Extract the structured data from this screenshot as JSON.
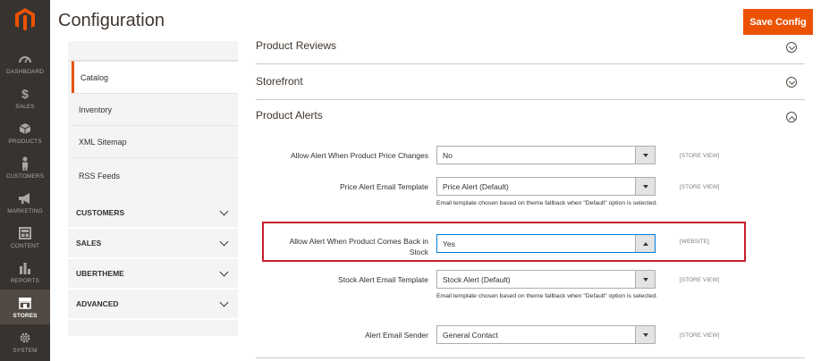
{
  "page": {
    "title": "Configuration",
    "save_label": "Save Config"
  },
  "colors": {
    "accent": "#eb5202",
    "nav_bg": "#373330",
    "highlight": "#c81d2c"
  },
  "admin_nav": [
    {
      "label": "DASHBOARD",
      "icon": "dashboard-icon"
    },
    {
      "label": "SALES",
      "icon": "dollar-icon"
    },
    {
      "label": "PRODUCTS",
      "icon": "cube-icon"
    },
    {
      "label": "CUSTOMERS",
      "icon": "person-icon"
    },
    {
      "label": "MARKETING",
      "icon": "megaphone-icon"
    },
    {
      "label": "CONTENT",
      "icon": "layout-icon"
    },
    {
      "label": "REPORTS",
      "icon": "bar-chart-icon"
    },
    {
      "label": "STORES",
      "icon": "store-icon",
      "active": true
    },
    {
      "label": "SYSTEM",
      "icon": "gear-icon"
    }
  ],
  "config_tabs": {
    "catalog_items": [
      "Catalog",
      "Inventory",
      "XML Sitemap",
      "RSS Feeds"
    ],
    "groups": [
      "CUSTOMERS",
      "SALES",
      "UBERTHEME",
      "ADVANCED"
    ]
  },
  "sections": {
    "product_reviews": "Product Reviews",
    "storefront": "Storefront",
    "product_alerts": "Product Alerts"
  },
  "product_alerts": {
    "rows": [
      {
        "label": "Allow Alert When Product Price Changes",
        "value": "No",
        "scope": "[STORE VIEW]"
      },
      {
        "label": "Price Alert Email Template",
        "value": "Price Alert (Default)",
        "scope": "[STORE VIEW]",
        "note": "Email template chosen based on theme fallback when \"Default\" option is selected."
      },
      {
        "label": "Allow Alert When Product Comes Back in Stock",
        "value": "Yes",
        "scope": "[WEBSITE]"
      },
      {
        "label": "Stock Alert Email Template",
        "value": "Stock Alert (Default)",
        "scope": "[STORE VIEW]",
        "note": "Email template chosen based on theme fallback when \"Default\" option is selected."
      },
      {
        "label": "Alert Email Sender",
        "value": "General Contact",
        "scope": "[STORE VIEW]"
      }
    ]
  }
}
